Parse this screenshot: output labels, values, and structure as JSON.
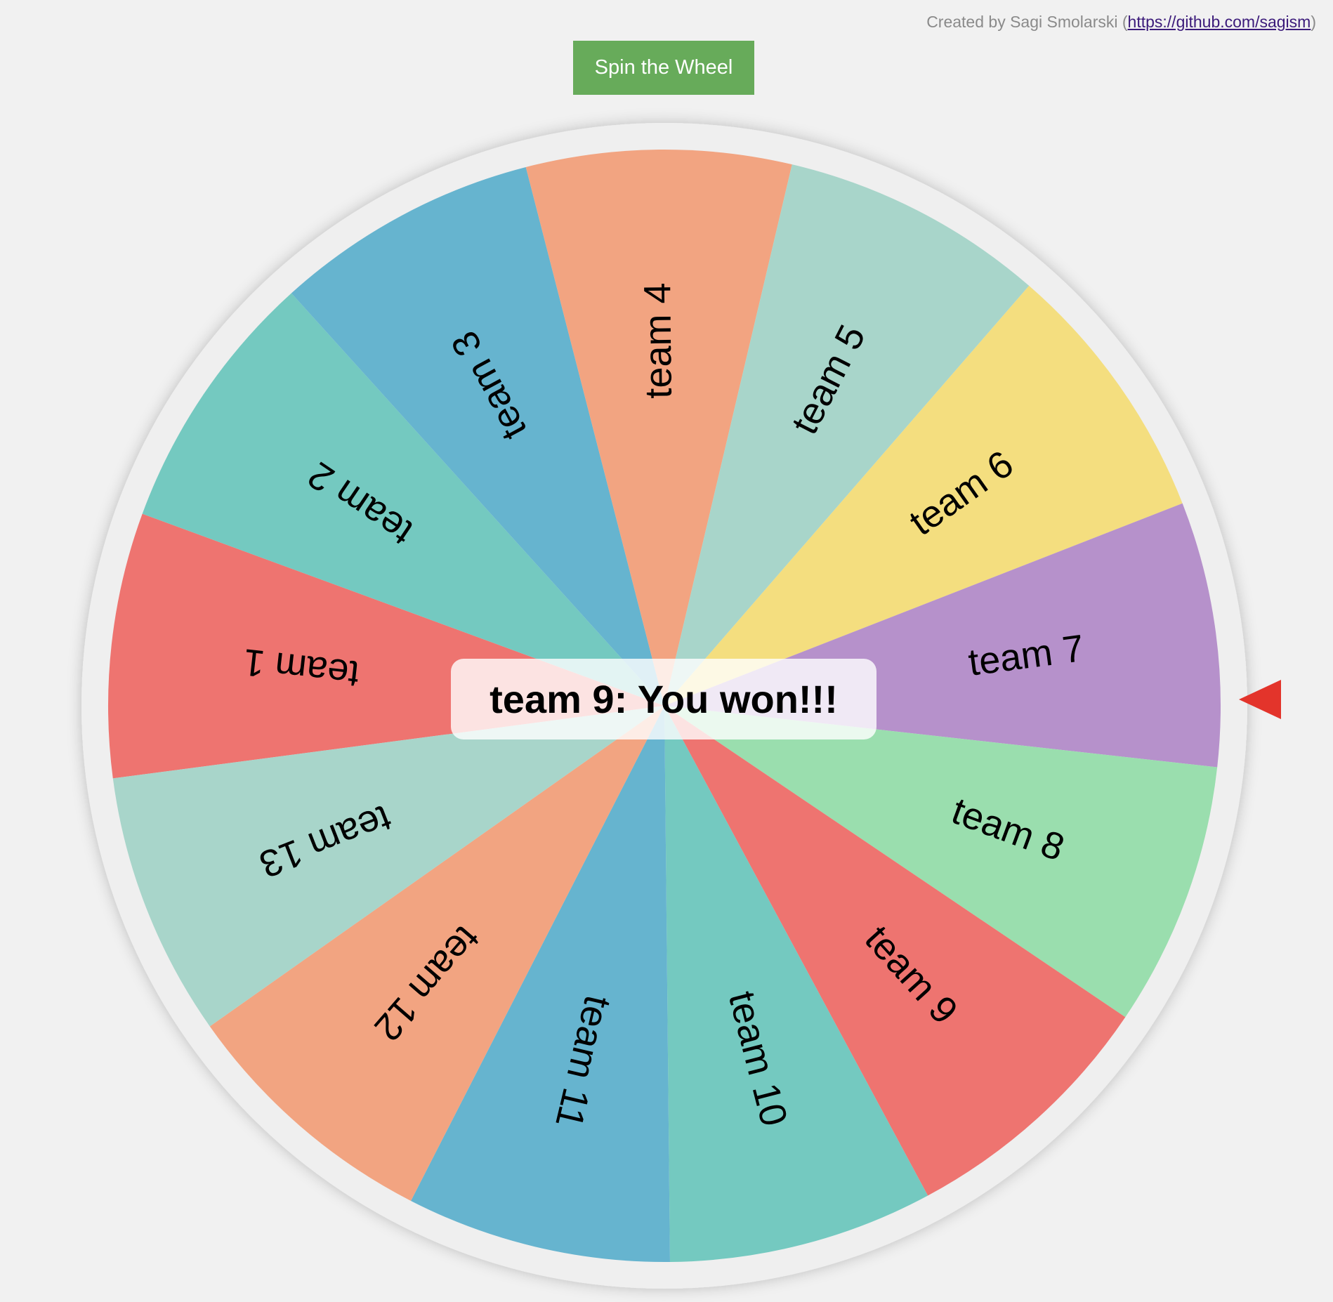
{
  "credit": {
    "prefix": "Created by Sagi Smolarski (",
    "link_text": "https://github.com/sagism",
    "suffix": ")"
  },
  "spin_button": {
    "label": "Spin the Wheel",
    "color": "#67ab5a"
  },
  "winner": {
    "text": "team 9: You won!!!"
  },
  "pointer": {
    "color": "#e3342b"
  },
  "wheel": {
    "rim_color": "#efefef",
    "segments": [
      {
        "label": "team 1",
        "color": "#ee7470"
      },
      {
        "label": "team 2",
        "color": "#74c9c0"
      },
      {
        "label": "team 3",
        "color": "#66b4cf"
      },
      {
        "label": "team 4",
        "color": "#f2a481"
      },
      {
        "label": "team 5",
        "color": "#a8d5ca"
      },
      {
        "label": "team 6",
        "color": "#f4de7f"
      },
      {
        "label": "team 7",
        "color": "#b691cb"
      },
      {
        "label": "team 8",
        "color": "#9adeae"
      },
      {
        "label": "team 9",
        "color": "#ee7470"
      },
      {
        "label": "team 10",
        "color": "#74c9c0"
      },
      {
        "label": "team 11",
        "color": "#66b4cf"
      },
      {
        "label": "team 12",
        "color": "#f2a481"
      },
      {
        "label": "team 13",
        "color": "#a8d5ca"
      }
    ]
  }
}
